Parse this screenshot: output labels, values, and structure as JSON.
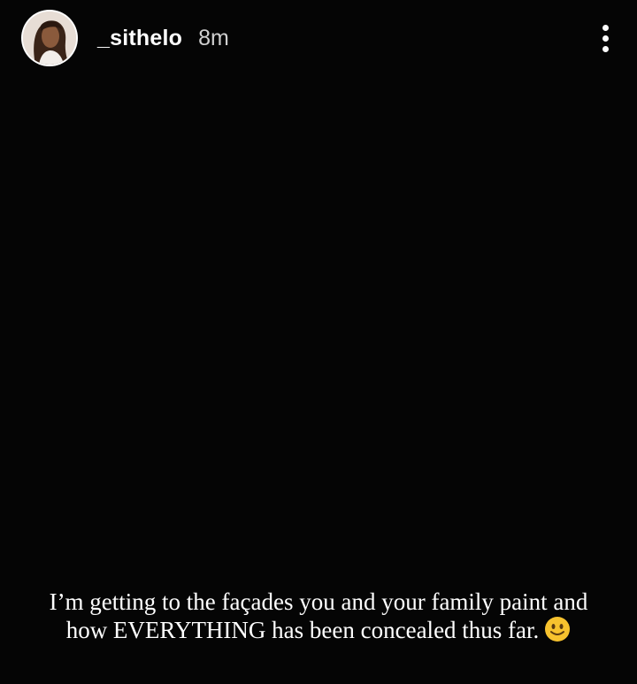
{
  "header": {
    "username": "_sithelo",
    "timestamp": "8m",
    "avatar_icon": "profile-photo",
    "menu_icon": "more-vertical-icon"
  },
  "caption": {
    "line1": "I’m getting to the façades you and your family paint and",
    "line2": "how EVERYTHING has been concealed thus far.",
    "emoji": "slightly-smiling-face-emoji"
  },
  "colors": {
    "background": "#050505",
    "text": "#ffffff",
    "timestamp": "#cfcfcf",
    "emoji_face": "#f7c22e"
  }
}
